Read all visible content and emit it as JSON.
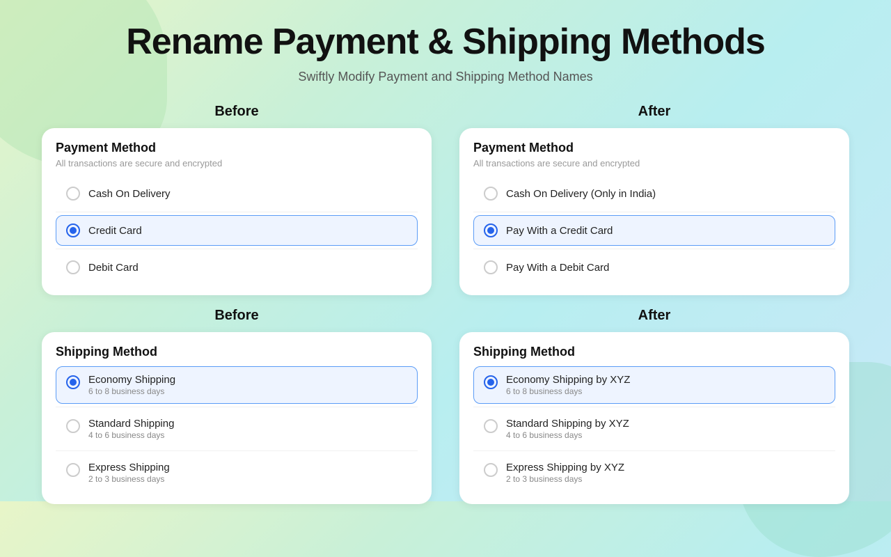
{
  "page": {
    "title": "Rename Payment & Shipping Methods",
    "subtitle": "Swiftly Modify Payment and Shipping Method Names"
  },
  "before_label": "Before",
  "after_label": "After",
  "payment_before": {
    "title": "Payment Method",
    "subtitle": "All transactions are secure and encrypted",
    "options": [
      {
        "label": "Cash On Delivery",
        "selected": false
      },
      {
        "label": "Credit Card",
        "selected": true
      },
      {
        "label": "Debit Card",
        "selected": false
      }
    ]
  },
  "payment_after": {
    "title": "Payment Method",
    "subtitle": "All transactions are secure and encrypted",
    "options": [
      {
        "label": "Cash On Delivery (Only in India)",
        "selected": false
      },
      {
        "label": "Pay With a Credit Card",
        "selected": true
      },
      {
        "label": "Pay With a Debit Card",
        "selected": false
      }
    ]
  },
  "shipping_before": {
    "title": "Shipping Method",
    "options": [
      {
        "label": "Economy Shipping",
        "sub": "6 to 8 business days",
        "selected": true
      },
      {
        "label": "Standard Shipping",
        "sub": "4 to 6 business days",
        "selected": false
      },
      {
        "label": "Express Shipping",
        "sub": "2 to 3 business days",
        "selected": false
      }
    ]
  },
  "shipping_after": {
    "title": "Shipping Method",
    "options": [
      {
        "label": "Economy Shipping by XYZ",
        "sub": "6 to 8 business days",
        "selected": true
      },
      {
        "label": "Standard Shipping by XYZ",
        "sub": "4 to 6 business days",
        "selected": false
      },
      {
        "label": "Express Shipping by XYZ",
        "sub": "2 to 3 business days",
        "selected": false
      }
    ]
  }
}
